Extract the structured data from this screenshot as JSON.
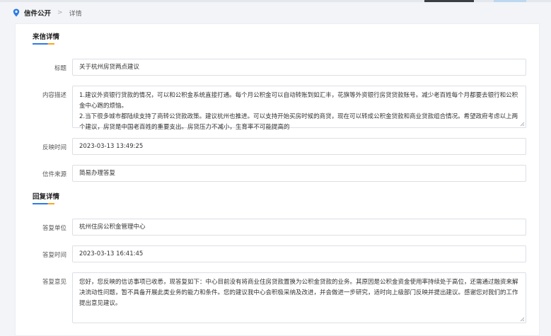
{
  "breadcrumb": {
    "main": "信件公开",
    "separator": ">",
    "sub": "详情"
  },
  "letter_section": {
    "title": "来信详情",
    "fields": {
      "title_label": "标题",
      "title_value": "关于杭州房贷两点建议",
      "content_label": "内容描述",
      "content_value": "1.建议外资银行贷款的情况，可以和公积金系统直接打通。每个月公积金可以自动转账到如汇丰，花旗等外资银行房贷贷款账号。减少老百姓每个月都要去银行和公积金中心跑的烦恼。\n2.当下很多城市都陆续支持了商转公贷款政策。建议杭州也推进。可以支持开始买房时候的商贷，现在可以转成公积金贷款和商业贷款组合情况。希望政府考虑以上两个建议，房贷是中国老百姓的重要支出。房贷压力不减小，生育率不可能提高的",
      "time_label": "反映时间",
      "time_value": "2023-03-13 13:49:25",
      "source_label": "信件来源",
      "source_value": "简易办理答复"
    }
  },
  "reply_section": {
    "title": "回复详情",
    "fields": {
      "unit_label": "答复单位",
      "unit_value": "杭州住房公积金管理中心",
      "time_label": "答复时间",
      "time_value": "2023-03-13 16:41:45",
      "opinion_label": "答复意见",
      "opinion_value": "您好，您反映的信访事项已收悉，现答复如下：中心目前没有将商业住房贷款置换为公积金贷款的业务。其原因是公积金资金使用率持续处于高位，还需通过融资来解决流动性问题，暂不具备开展此类业务的能力和条件。您的建议我中心会积极采纳及改进，并会做进一步研究，适时向上级部门反映并提出建议。感谢您对我们的工作提出意见建议。"
    }
  },
  "colors": {
    "accent_blue": "#2d7be5",
    "accent_orange": "#f5a623"
  },
  "icons": {
    "breadcrumb": "location-pin-icon"
  }
}
